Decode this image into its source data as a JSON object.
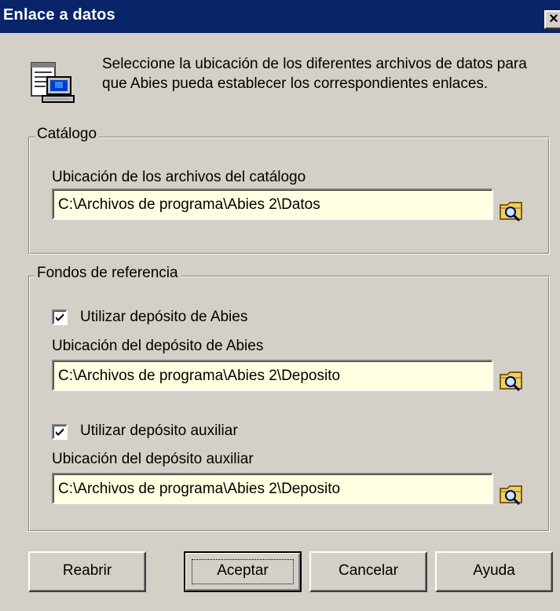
{
  "window": {
    "title": "Enlace a datos",
    "close_label": "×"
  },
  "intro_text": "Seleccione la ubicación de los diferentes archivos de datos para que Abies pueda establecer los correspondientes enlaces.",
  "catalog": {
    "legend": "Catálogo",
    "label": "Ubicación de los archivos del catálogo",
    "value": "C:\\Archivos de programa\\Abies 2\\Datos"
  },
  "references": {
    "legend": "Fondos de referencia",
    "abies_check_label": "Utilizar depósito de Abies",
    "abies_checked": true,
    "abies_label": "Ubicación del depósito de Abies",
    "abies_value": "C:\\Archivos de programa\\Abies 2\\Deposito",
    "aux_check_label": "Utilizar depósito auxiliar",
    "aux_checked": true,
    "aux_label": "Ubicación del depósito auxiliar",
    "aux_value": "C:\\Archivos de programa\\Abies 2\\Deposito"
  },
  "buttons": {
    "reopen": "Reabrir",
    "accept": "Aceptar",
    "cancel": "Cancelar",
    "help": "Ayuda"
  },
  "colors": {
    "titlebar": "#0a246a",
    "window_bg": "#d4d0c8",
    "field_bg": "#ffffe1"
  },
  "icons": {
    "dialog": "computer-data-icon",
    "browse": "folder-search-icon",
    "close": "close-icon"
  }
}
